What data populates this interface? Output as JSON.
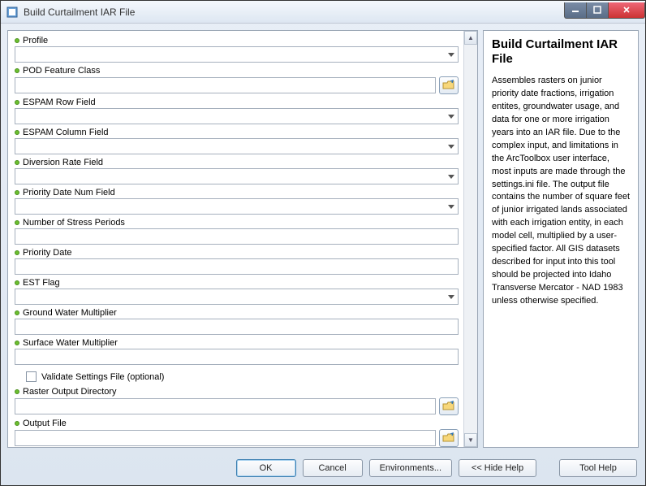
{
  "window": {
    "title": "Build Curtailment IAR File"
  },
  "fields": {
    "profile": {
      "label": "Profile",
      "type": "dropdown",
      "value": ""
    },
    "pod": {
      "label": "POD Feature Class",
      "type": "text+browse",
      "value": ""
    },
    "espam_row": {
      "label": "ESPAM Row Field",
      "type": "dropdown",
      "value": ""
    },
    "espam_col": {
      "label": "ESPAM Column Field",
      "type": "dropdown",
      "value": ""
    },
    "diversion": {
      "label": "Diversion Rate Field",
      "type": "dropdown",
      "value": ""
    },
    "priority_num": {
      "label": "Priority Date Num Field",
      "type": "dropdown",
      "value": ""
    },
    "stress": {
      "label": "Number of Stress Periods",
      "type": "text",
      "value": ""
    },
    "priority_date": {
      "label": "Priority Date",
      "type": "text",
      "value": ""
    },
    "est_flag": {
      "label": "EST Flag",
      "type": "dropdown",
      "value": ""
    },
    "gw_mult": {
      "label": "Ground Water Multiplier",
      "type": "text",
      "value": ""
    },
    "sw_mult": {
      "label": "Surface Water Multiplier",
      "type": "text",
      "value": ""
    },
    "validate": {
      "label": "Validate Settings File (optional)",
      "checked": false
    },
    "raster_out": {
      "label": "Raster Output Directory",
      "type": "text+browse",
      "value": ""
    },
    "output_file": {
      "label": "Output File",
      "type": "text+browse",
      "value": ""
    }
  },
  "buttons": {
    "ok": "OK",
    "cancel": "Cancel",
    "environments": "Environments...",
    "hide_help": "<< Hide Help",
    "tool_help": "Tool Help"
  },
  "help": {
    "title": "Build Curtailment IAR File",
    "body": "Assembles rasters on junior priority date fractions, irrigation entites, groundwater usage, and data for one or more irrigation years into an IAR file. Due to the complex input, and limitations in the ArcToolbox user interface, most inputs are made through the settings.ini file. The output file contains the number of square feet of junior irrigated lands associated with each irrigation entity, in each model cell, multiplied by a user-specified factor. All GIS datasets described for input into this tool should be projected into Idaho Transverse Mercator - NAD 1983 unless otherwise specified."
  }
}
